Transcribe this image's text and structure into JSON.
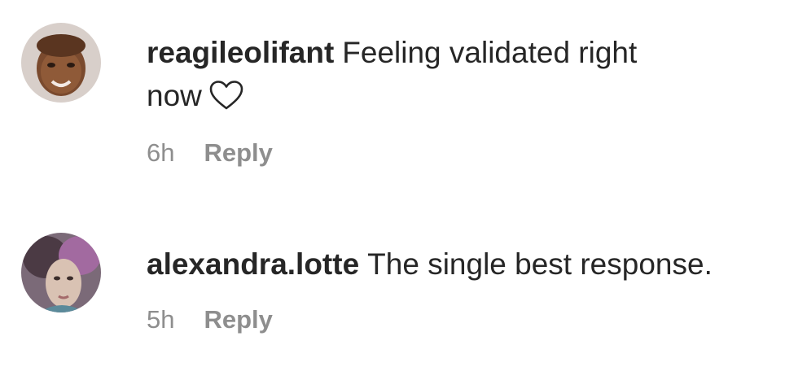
{
  "comments": [
    {
      "username": "reagileolifant",
      "text_line1": "Feeling validated right",
      "text_line2": "now",
      "emoji": "white-heart-icon",
      "time": "6h",
      "reply_label": "Reply"
    },
    {
      "username": "alexandra.lotte",
      "text_line1": "The single best response.",
      "time": "5h",
      "reply_label": "Reply"
    }
  ],
  "colors": {
    "text": "#262626",
    "secondary": "#8e8e8e",
    "background": "#ffffff"
  }
}
